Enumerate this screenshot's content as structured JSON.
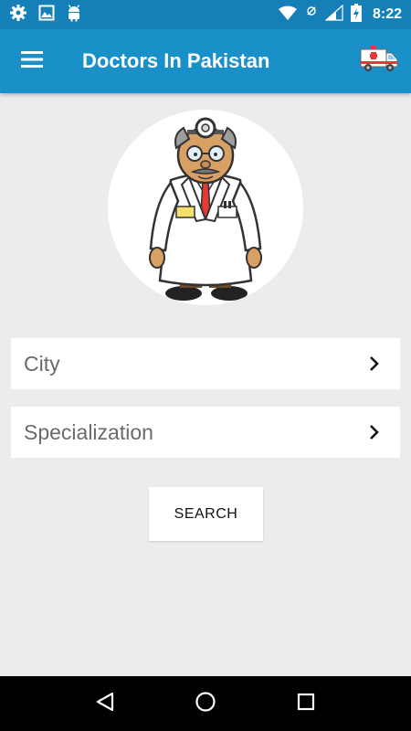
{
  "status_bar": {
    "time": "8:22",
    "icons": [
      "gear-icon",
      "image-icon",
      "android-icon",
      "wifi-icon",
      "no-data-icon",
      "signal-icon",
      "battery-charging-icon"
    ]
  },
  "app_bar": {
    "title": "Doctors In Pakistan",
    "menu_icon": "hamburger-menu-icon",
    "action_icon": "ambulance-icon",
    "color": "#1a90c9"
  },
  "form": {
    "city": {
      "label": "City",
      "icon": "chevron-right-icon"
    },
    "specialization": {
      "label": "Specialization",
      "icon": "chevron-right-icon"
    },
    "search_label": "SEARCH"
  },
  "nav_bar": {
    "buttons": [
      "back-icon",
      "home-icon",
      "recents-icon"
    ]
  }
}
